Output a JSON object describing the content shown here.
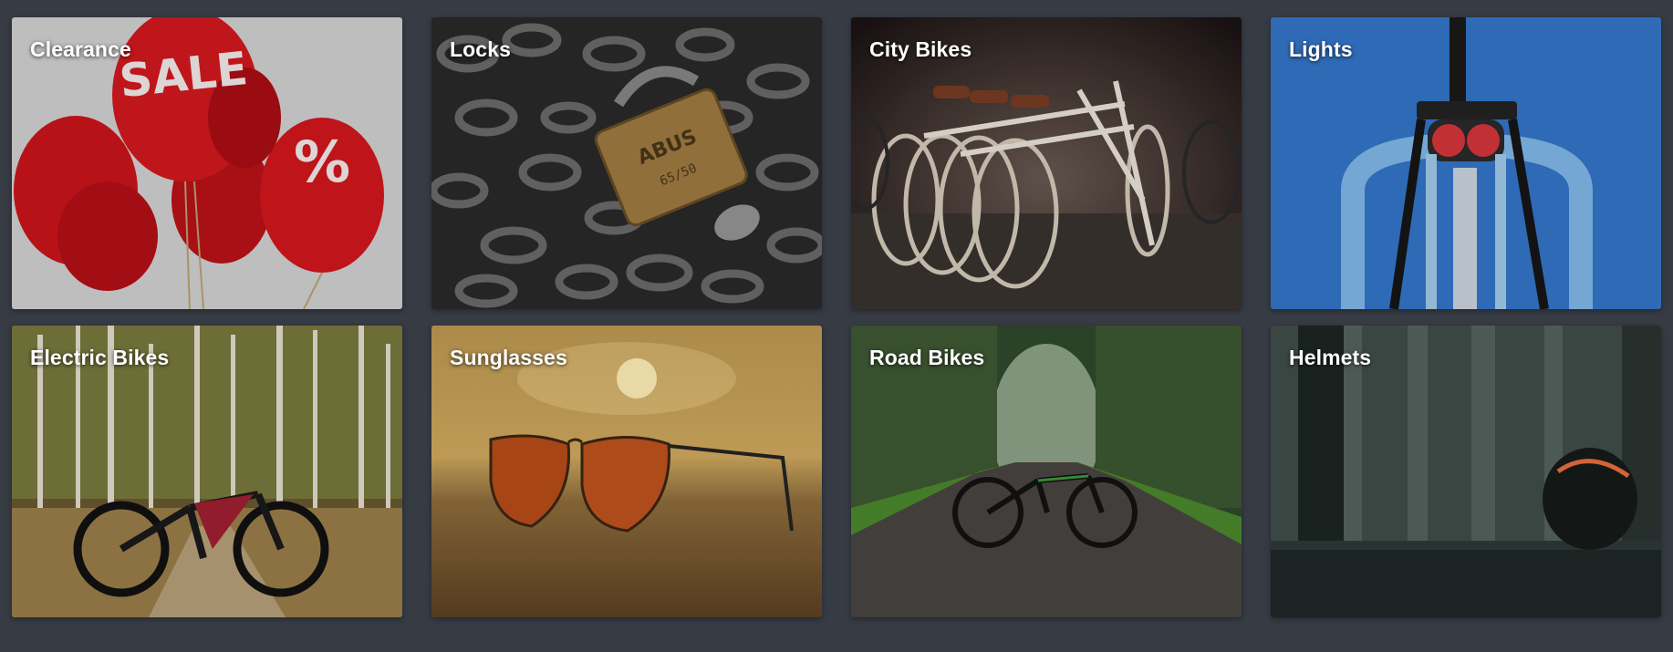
{
  "categories": [
    {
      "id": "clearance",
      "label": "Clearance",
      "image": "sale-balloons"
    },
    {
      "id": "locks",
      "label": "Locks",
      "image": "padlock-on-chains"
    },
    {
      "id": "city-bikes",
      "label": "City Bikes",
      "image": "row-of-white-city-bikes"
    },
    {
      "id": "lights",
      "label": "Lights",
      "image": "bike-rear-light-blue-wall"
    },
    {
      "id": "electric-bikes",
      "label": "Electric Bikes",
      "image": "mountain-bike-in-forest"
    },
    {
      "id": "sunglasses",
      "label": "Sunglasses",
      "image": "aviator-sunglasses-sunset"
    },
    {
      "id": "road-bikes",
      "label": "Road Bikes",
      "image": "bike-on-forest-road"
    },
    {
      "id": "helmets",
      "label": "Helmets",
      "image": "helmet-on-ledge-forest"
    }
  ],
  "colors": {
    "background": "#363b44",
    "label_text": "#ffffff"
  }
}
